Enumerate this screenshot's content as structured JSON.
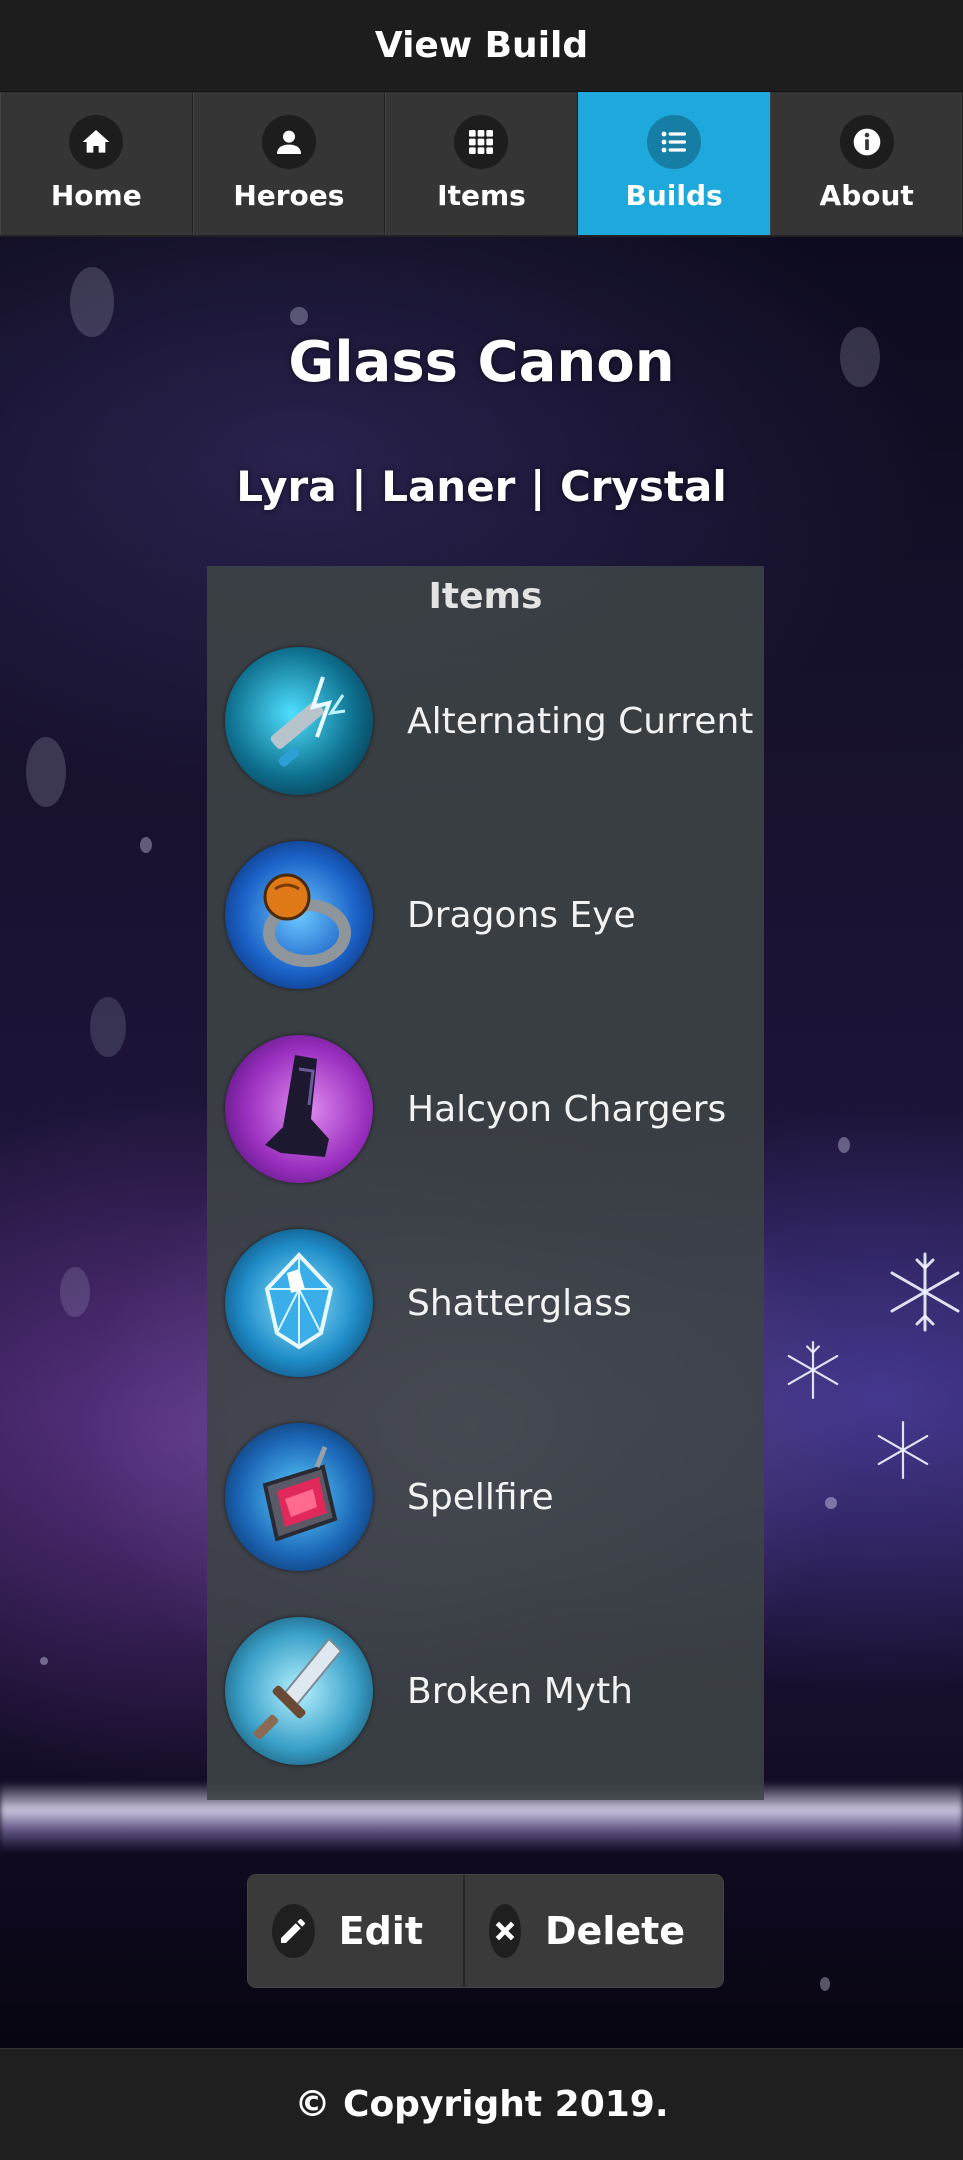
{
  "header": {
    "title": "View Build"
  },
  "nav": {
    "items": [
      {
        "label": "Home",
        "icon": "home-icon",
        "active": false
      },
      {
        "label": "Heroes",
        "icon": "user-icon",
        "active": false
      },
      {
        "label": "Items",
        "icon": "grid-icon",
        "active": false
      },
      {
        "label": "Builds",
        "icon": "list-icon",
        "active": true
      },
      {
        "label": "About",
        "icon": "info-icon",
        "active": false
      }
    ],
    "active_color": "#1ea8dc"
  },
  "build": {
    "title": "Glass Canon",
    "meta": "Lyra | Laner | Crystal"
  },
  "items_panel": {
    "heading": "Items",
    "items": [
      {
        "name": "Alternating Current",
        "icon": "alternating-current-icon"
      },
      {
        "name": "Dragons Eye",
        "icon": "dragons-eye-icon"
      },
      {
        "name": "Halcyon Chargers",
        "icon": "halcyon-chargers-icon"
      },
      {
        "name": "Shatterglass",
        "icon": "shatterglass-icon"
      },
      {
        "name": "Spellfire",
        "icon": "spellfire-icon"
      },
      {
        "name": "Broken Myth",
        "icon": "broken-myth-icon"
      }
    ]
  },
  "actions": {
    "edit_label": "Edit",
    "delete_label": "Delete"
  },
  "footer": {
    "text": "© Copyright 2019."
  }
}
